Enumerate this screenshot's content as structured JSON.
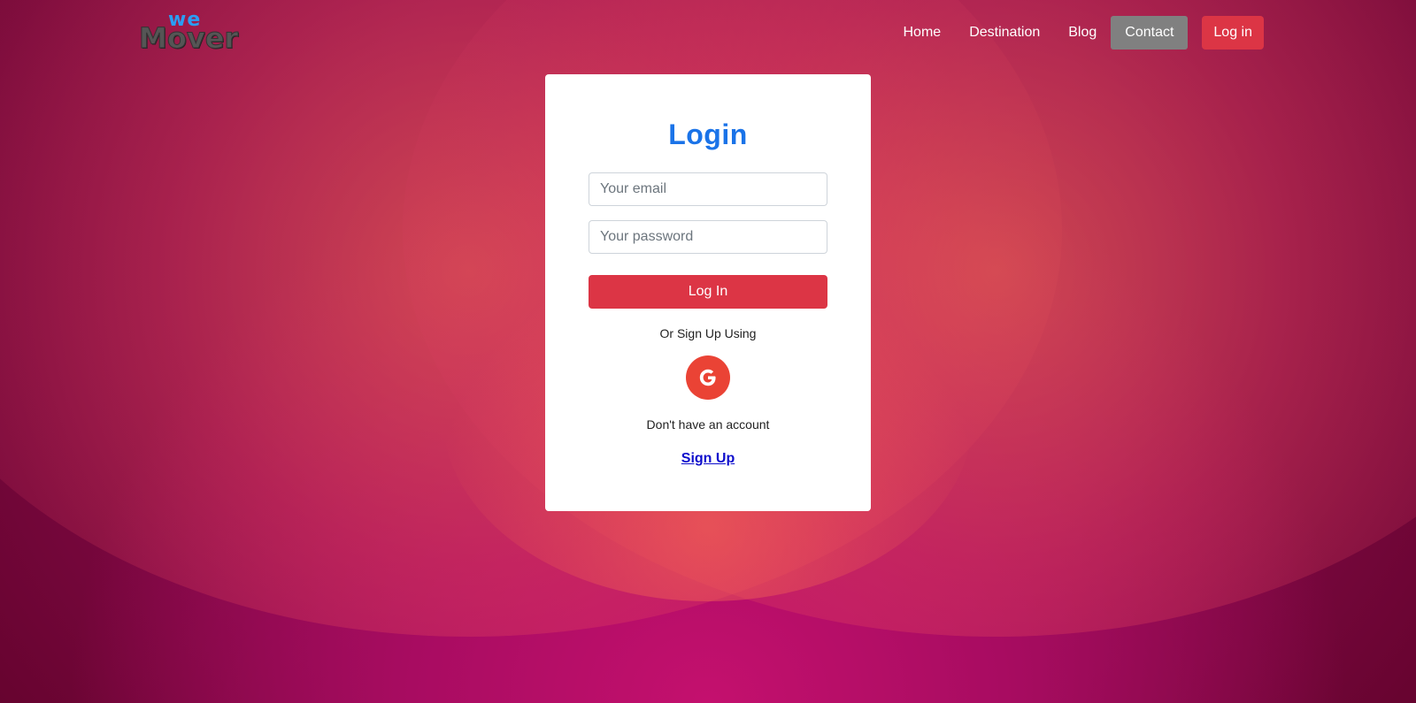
{
  "brand": {
    "logo_top": "we",
    "logo_bottom": "Mover"
  },
  "nav": {
    "items": [
      "Home",
      "Destination",
      "Blog",
      "Contact"
    ],
    "login_label": "Log in"
  },
  "login": {
    "title": "Login",
    "email_placeholder": "Your email",
    "password_placeholder": "Your password",
    "submit_label": "Log In",
    "alt_text": "Or Sign Up Using",
    "google_icon": "google-g-icon",
    "no_account_text": "Don't have an account",
    "signup_link": "Sign Up"
  },
  "colors": {
    "accent_red": "#dc3545",
    "title_blue": "#1a73e8",
    "google_red": "#ea4335",
    "contact_gray": "#808080"
  }
}
